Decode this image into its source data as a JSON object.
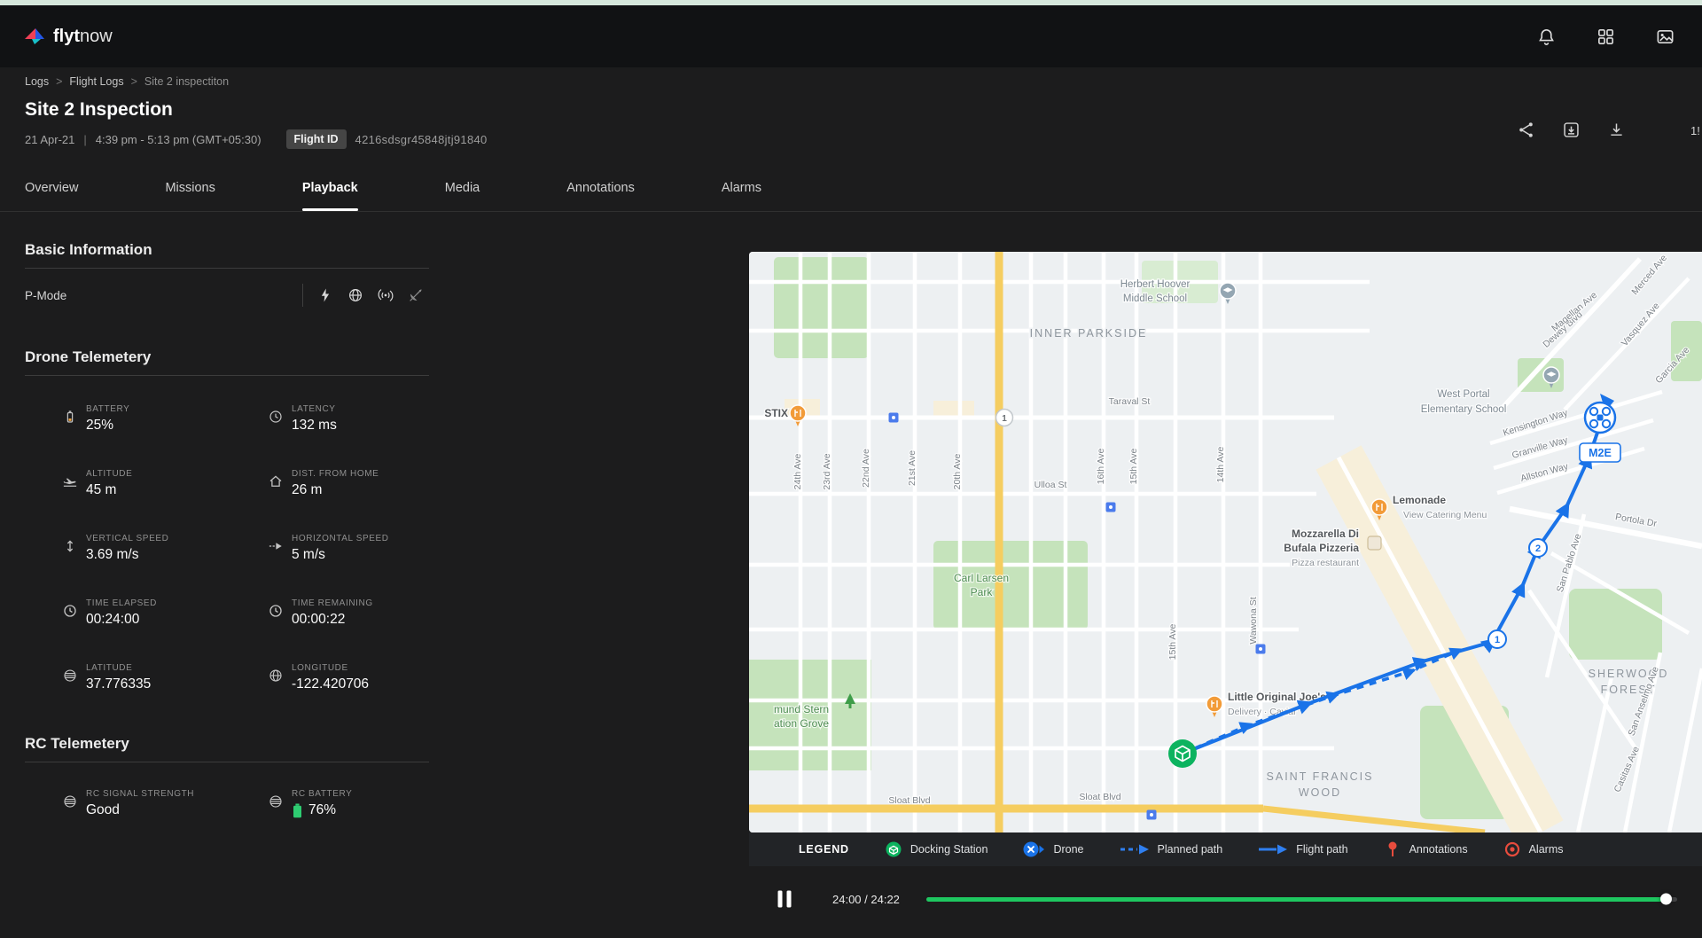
{
  "header": {
    "logo_flyt": "flyt",
    "logo_now": "now",
    "icons": [
      "bell-icon",
      "apps-grid-icon",
      "media-icon"
    ]
  },
  "breadcrumb": {
    "separator": ">",
    "items": [
      "Logs",
      "Flight Logs",
      "Site 2 inspectiton"
    ]
  },
  "title_block": {
    "title": "Site 2 Inspection",
    "date": "21 Apr-21",
    "separator": "|",
    "time_range": "4:39 pm - 5:13 pm (GMT+05:30)",
    "flight_id_label": "Flight ID",
    "flight_id_value": "4216sdsgr45848jtj91840",
    "edge_badge": "1!"
  },
  "actions": {
    "icons": [
      "share-icon",
      "save-icon",
      "download-icon"
    ]
  },
  "tabs": [
    {
      "label": "Overview",
      "active": false
    },
    {
      "label": "Missions",
      "active": false
    },
    {
      "label": "Playback",
      "active": true
    },
    {
      "label": "Media",
      "active": false
    },
    {
      "label": "Annotations",
      "active": false
    },
    {
      "label": "Alarms",
      "active": false
    }
  ],
  "panel": {
    "basic_information": {
      "heading": "Basic Information",
      "mode": "P-Mode",
      "status_icons": [
        "flash-icon",
        "network-globe-icon",
        "rc-signal-icon",
        "satellite-off-icon"
      ]
    },
    "drone_telemetry": {
      "heading": "Drone Telemetery",
      "items": [
        {
          "label": "BATTERY",
          "value": "25%",
          "icon": "battery-icon"
        },
        {
          "label": "LATENCY",
          "value": "132 ms",
          "icon": "clock-icon"
        },
        {
          "label": "ALTITUDE",
          "value": "45 m",
          "icon": "plane-takeoff-icon"
        },
        {
          "label": "DIST. FROM HOME",
          "value": "26 m",
          "icon": "home-icon"
        },
        {
          "label": "VERTICAL SPEED",
          "value": "3.69 m/s",
          "icon": "vertical-arrows-icon"
        },
        {
          "label": "HORIZONTAL SPEED",
          "value": "5 m/s",
          "icon": "dashed-arrow-icon"
        },
        {
          "label": "TIME ELAPSED",
          "value": "00:24:00",
          "icon": "clock-icon"
        },
        {
          "label": "TIME REMAINING",
          "value": "00:00:22",
          "icon": "clock-icon"
        },
        {
          "label": "LATITUDE",
          "value": "37.776335",
          "icon": "globe-icon"
        },
        {
          "label": "LONGITUDE",
          "value": "-122.420706",
          "icon": "globe-icon"
        }
      ]
    },
    "rc_telemetry": {
      "heading": "RC Telemetery",
      "items": [
        {
          "label": "RC SIGNAL STRENGTH",
          "value": "Good",
          "icon": "globe-icon"
        },
        {
          "label": "RC BATTERY",
          "value": "76%",
          "icon": "globe-icon"
        }
      ]
    }
  },
  "map": {
    "labels": {
      "inner_parkside": "INNER PARKSIDE",
      "sherwood1": "SHERWOOD",
      "sherwood2": "FOREST",
      "francis1": "SAINT FRANCIS",
      "francis2": "WOOD",
      "hoover1": "Herbert Hoover",
      "hoover2": "Middle School",
      "west_portal1": "West Portal",
      "west_portal2": "Elementary School",
      "mozza1": "Mozzarella Di",
      "mozza2": "Bufala Pizzeria",
      "mozza_sub": "Pizza restaurant",
      "lemonade": "Lemonade",
      "lemonade_sub": "View Catering Menu",
      "joes": "Little Original Joe's",
      "joes_sub": "Delivery · Caviar",
      "carl1": "Carl Larsen",
      "carl2": "Park",
      "stern1": "mund Stern",
      "stern2": "ation Grove",
      "stix": "STIX",
      "taraval": "Taraval St",
      "ulloa": "Ulloa St",
      "sloat1": "Sloat Blvd",
      "sloat2": "Sloat Blvd",
      "wawona": "Wawona St",
      "ave24": "24th Ave",
      "ave23": "23rd Ave",
      "ave22": "22nd Ave",
      "ave21": "21st Ave",
      "ave20": "20th Ave",
      "ave16": "16th Ave",
      "ave15": "15th Ave",
      "ave14": "14th Ave",
      "ave15b": "15th Ave",
      "dewey": "Dewey Blvd",
      "merced": "Merced Ave",
      "vasquez": "Vasquez Ave",
      "garcia": "Garcia Ave",
      "magellan": "Magellan Ave",
      "kensington": "Kensington Way",
      "granville": "Granville Way",
      "allston": "Allston Way",
      "portola": "Portola Dr",
      "san_pablo": "San Pablo Ave",
      "san_anselmo": "San Anselmo Ave",
      "casitas": "Casitas Ave",
      "shield1": "1",
      "drone_label": "M2E",
      "wp1": "1",
      "wp2": "2"
    }
  },
  "legend": {
    "title": "LEGEND",
    "items": [
      {
        "label": "Docking Station",
        "icon": "docking-station-icon"
      },
      {
        "label": "Drone",
        "icon": "drone-icon"
      },
      {
        "label": "Planned path",
        "icon": "planned-path-icon"
      },
      {
        "label": "Flight path",
        "icon": "flight-path-icon"
      },
      {
        "label": "Annotations",
        "icon": "annotation-pin-icon"
      },
      {
        "label": "Alarms",
        "icon": "alarm-icon"
      }
    ]
  },
  "playback": {
    "time": "24:00 / 24:22",
    "progress_pct": 98.5
  },
  "colors": {
    "path_blue": "#1a73e8",
    "progress_green": "#1ec760",
    "dock_green": "#0cb35f",
    "battery_orange": "#f2a33c",
    "rc_battery_green": "#2ecc71",
    "alert_red": "#e84c3d"
  }
}
